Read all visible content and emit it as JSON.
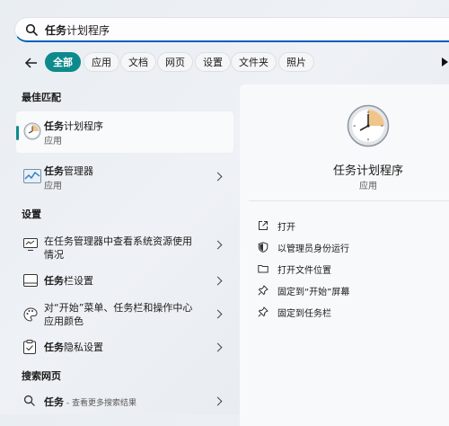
{
  "search": {
    "query_bold": "任务",
    "query_rest": "计划程序"
  },
  "filters": [
    "全部",
    "应用",
    "文档",
    "网页",
    "设置",
    "文件夹",
    "照片"
  ],
  "sections": {
    "best_match": "最佳匹配",
    "settings": "设置",
    "web": "搜索网页"
  },
  "best_match": {
    "title_bold": "任务",
    "title_rest": "计划程序",
    "sub": "应用"
  },
  "apps": [
    {
      "title_bold": "任务",
      "title_rest": "管理器",
      "sub": "应用"
    }
  ],
  "settings_items": [
    {
      "line1": "在任务管理器中查看系统资源使用",
      "line2": "情况"
    },
    {
      "title_bold": "任务",
      "title_rest": "栏设置"
    },
    {
      "line1": "对“开始”菜单、任务栏和操作中心",
      "line2": "应用颜色"
    },
    {
      "title_bold": "任务",
      "title_rest": "隐私设置"
    }
  ],
  "web_result": {
    "bold": "任务",
    "rest": " - 查看更多搜索结果"
  },
  "detail": {
    "title": "任务计划程序",
    "sub": "应用",
    "actions": [
      "打开",
      "以管理员身份运行",
      "打开文件位置",
      "固定到“开始”屏幕",
      "固定到任务栏"
    ]
  },
  "colors": {
    "accent": "#0f8a8c",
    "search_underline": "#005fb8"
  }
}
